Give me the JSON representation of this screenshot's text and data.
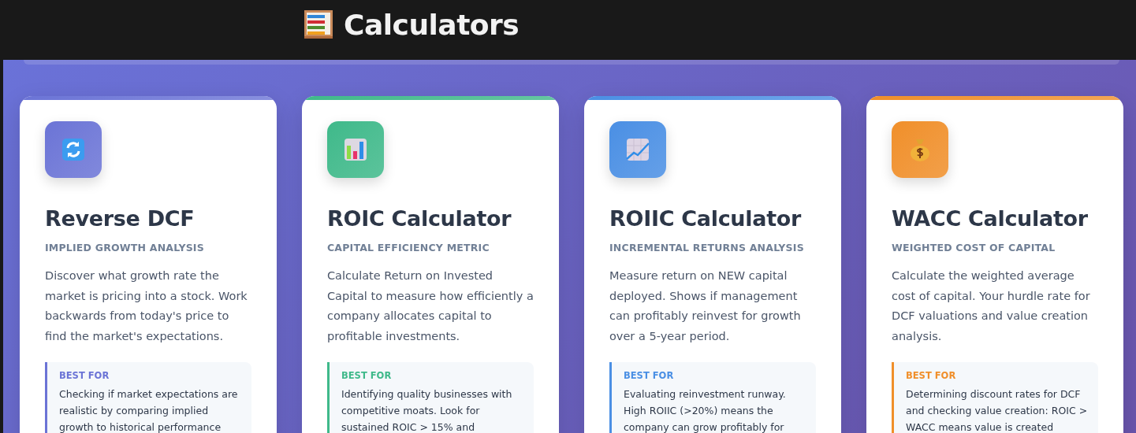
{
  "header": {
    "title": "Calculators"
  },
  "cards": [
    {
      "kind": "refresh",
      "color": "#6b74d6",
      "title": "Reverse DCF",
      "subtitle": "IMPLIED GROWTH ANALYSIS",
      "description": "Discover what growth rate the market is pricing into a stock. Work backwards from today's price to find the market's expectations.",
      "best_for": {
        "label": "BEST FOR",
        "text": "Checking if market expectations are realistic by comparing implied growth to historical performance"
      }
    },
    {
      "kind": "bar-chart",
      "color": "#3fb98a",
      "title": "ROIC Calculator",
      "subtitle": "CAPITAL EFFICIENCY METRIC",
      "description": "Calculate Return on Invested Capital to measure how efficiently a company allocates capital to profitable investments.",
      "best_for": {
        "label": "BEST FOR",
        "text": "Identifying quality businesses with competitive moats. Look for sustained ROIC > 15% and"
      }
    },
    {
      "kind": "line-chart",
      "color": "#4a8fe4",
      "title": "ROIIC Calculator",
      "subtitle": "INCREMENTAL RETURNS ANALYSIS",
      "description": "Measure return on NEW capital deployed. Shows if management can profitably reinvest for growth over a 5-year period.",
      "best_for": {
        "label": "BEST FOR",
        "text": "Evaluating reinvestment runway. High ROIIC (>20%) means the company can grow profitably for"
      }
    },
    {
      "kind": "money-bag",
      "color": "#f08f2a",
      "title": "WACC Calculator",
      "subtitle": "WEIGHTED COST OF CAPITAL",
      "description": "Calculate the weighted average cost of capital. Your hurdle rate for DCF valuations and value creation analysis.",
      "best_for": {
        "label": "BEST FOR",
        "text": "Determining discount rates for DCF and checking value creation: ROIC > WACC means value is created"
      }
    }
  ]
}
